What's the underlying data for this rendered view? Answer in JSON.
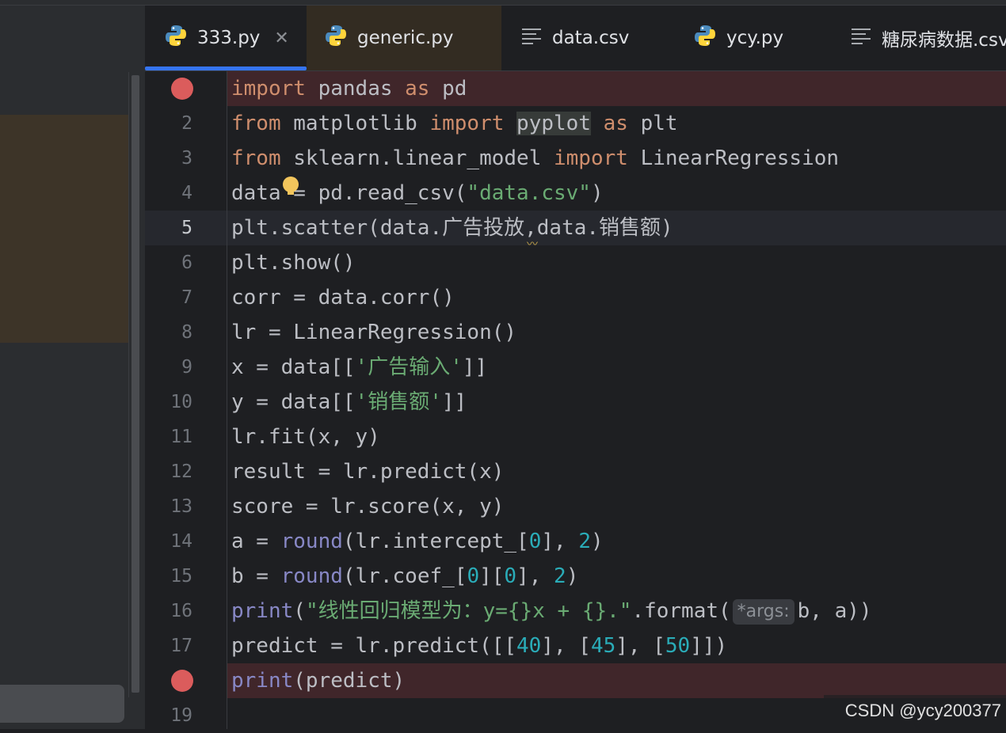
{
  "tabs": [
    {
      "label": "333.py",
      "icon": "python-icon",
      "active": true,
      "close": "✕"
    },
    {
      "label": "generic.py",
      "icon": "python-icon"
    },
    {
      "label": "data.csv",
      "icon": "text-file-icon"
    },
    {
      "label": "ycy.py",
      "icon": "python-icon"
    },
    {
      "label": "糖尿病数据.csv",
      "icon": "text-file-icon"
    }
  ],
  "line_numbers": [
    "2",
    "3",
    "4",
    "5",
    "6",
    "7",
    "8",
    "9",
    "10",
    "11",
    "12",
    "13",
    "14",
    "15",
    "16",
    "17",
    "19"
  ],
  "code": {
    "l1": [
      "import",
      " pandas ",
      "as",
      " pd"
    ],
    "l2": [
      "from",
      " matplotlib ",
      "import",
      " ",
      "pyplot",
      " ",
      "as",
      " plt"
    ],
    "l3": [
      "from",
      " sklearn.linear_model ",
      "import",
      " LinearRegression"
    ],
    "l4": [
      "data = pd.read_csv(",
      "\"data.csv\"",
      ")"
    ],
    "l5": "plt.scatter(data.广告投放,data.销售额)",
    "l6": "plt.show()",
    "l7": "corr = data.corr()",
    "l8": "lr = LinearRegression()",
    "l9": [
      "x = data[[",
      "'广告输入'",
      "]]"
    ],
    "l10": [
      "y = data[[",
      "'销售额'",
      "]]"
    ],
    "l11": "lr.fit(x, y)",
    "l12": "result = lr.predict(x)",
    "l13": "score = lr.score(x, y)",
    "l14": [
      "a = ",
      "round",
      "(lr.intercept_[",
      "0",
      "], ",
      "2",
      ")"
    ],
    "l15": [
      "b = ",
      "round",
      "(lr.coef_[",
      "0",
      "][",
      "0",
      "], ",
      "2",
      ")"
    ],
    "l16": [
      "print",
      "(",
      "\"线性回归模型为：y={}x + {}.\"",
      ".format(",
      "*args:",
      "b, a))"
    ],
    "l17": [
      "predict = lr.predict([[",
      "40",
      "], [",
      "45",
      "], [",
      "50",
      "]])"
    ],
    "l18": [
      "print",
      "(predict)"
    ]
  },
  "watermark": "CSDN @ycy200377",
  "colors": {
    "keyword": "#cf8e6d",
    "string": "#6aab73",
    "number": "#2aacb8",
    "builtin": "#8888c6",
    "breakpoint": "#db5c5c",
    "accent": "#3574f0"
  }
}
